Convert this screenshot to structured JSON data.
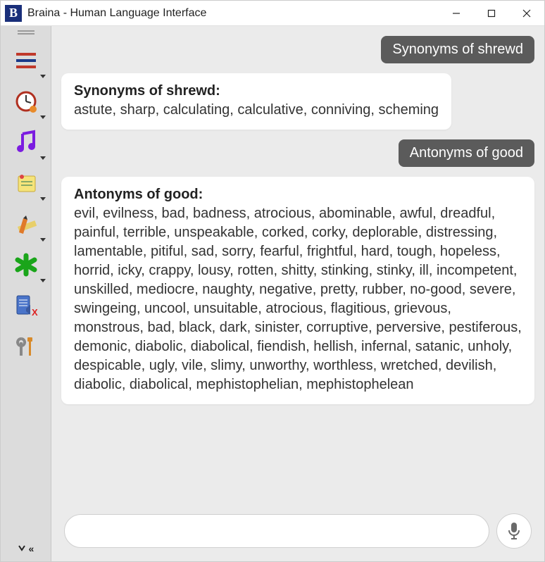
{
  "window": {
    "title": "Braina - Human Language Interface",
    "app_icon_letter": "B"
  },
  "sidebar": {
    "items": [
      {
        "name": "menu"
      },
      {
        "name": "alarm"
      },
      {
        "name": "music"
      },
      {
        "name": "notes"
      },
      {
        "name": "pencil"
      },
      {
        "name": "asterisk"
      },
      {
        "name": "mute"
      },
      {
        "name": "tools"
      }
    ]
  },
  "chat": {
    "messages": [
      {
        "role": "user",
        "text": "Synonyms of shrewd"
      },
      {
        "role": "bot",
        "heading": "Synonyms of shrewd:",
        "body": "astute, sharp, calculating, calculative, conniving, scheming"
      },
      {
        "role": "user",
        "text": "Antonyms of good"
      },
      {
        "role": "bot",
        "heading": "Antonyms of good:",
        "body": "evil, evilness, bad, badness, atrocious, abominable, awful, dreadful, painful, terrible, unspeakable, corked, corky, deplorable, distressing, lamentable, pitiful, sad, sorry, fearful, frightful, hard, tough, hopeless, horrid, icky, crappy, lousy, rotten, shitty, stinking, stinky, ill, incompetent, unskilled, mediocre, naughty, negative, pretty, rubber, no-good, severe, swingeing, uncool, unsuitable, atrocious, flagitious, grievous, monstrous, bad, black, dark, sinister, corruptive, perversive, pestiferous, demonic, diabolic, diabolical, fiendish, hellish, infernal, satanic, unholy, despicable, ugly, vile, slimy, unworthy, worthless, wretched, devilish, diabolic, diabolical, mephistophelian, mephistophelean"
      }
    ],
    "input_value": ""
  }
}
